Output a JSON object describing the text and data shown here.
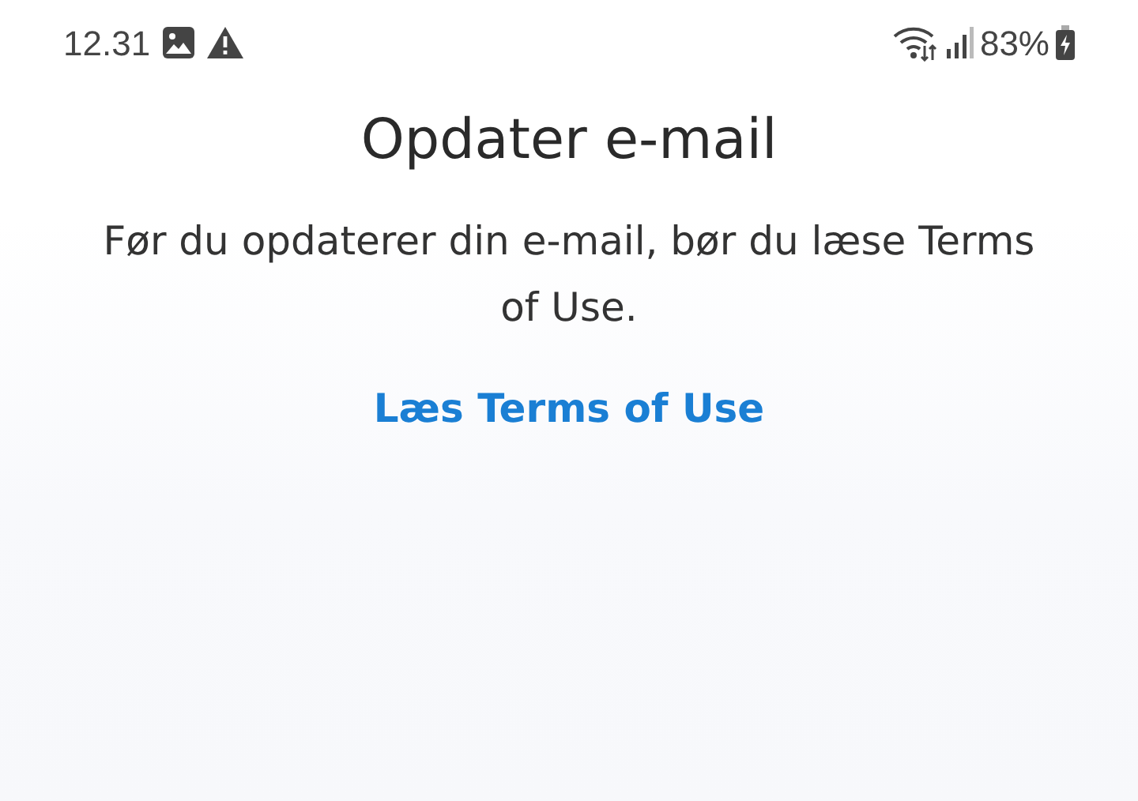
{
  "status_bar": {
    "time": "12.31",
    "battery": "83%"
  },
  "title": "Opdater e-mail",
  "message": "Før du opdaterer din e-mail, bør du læse Terms of Use.",
  "link": "Læs Terms of Use"
}
